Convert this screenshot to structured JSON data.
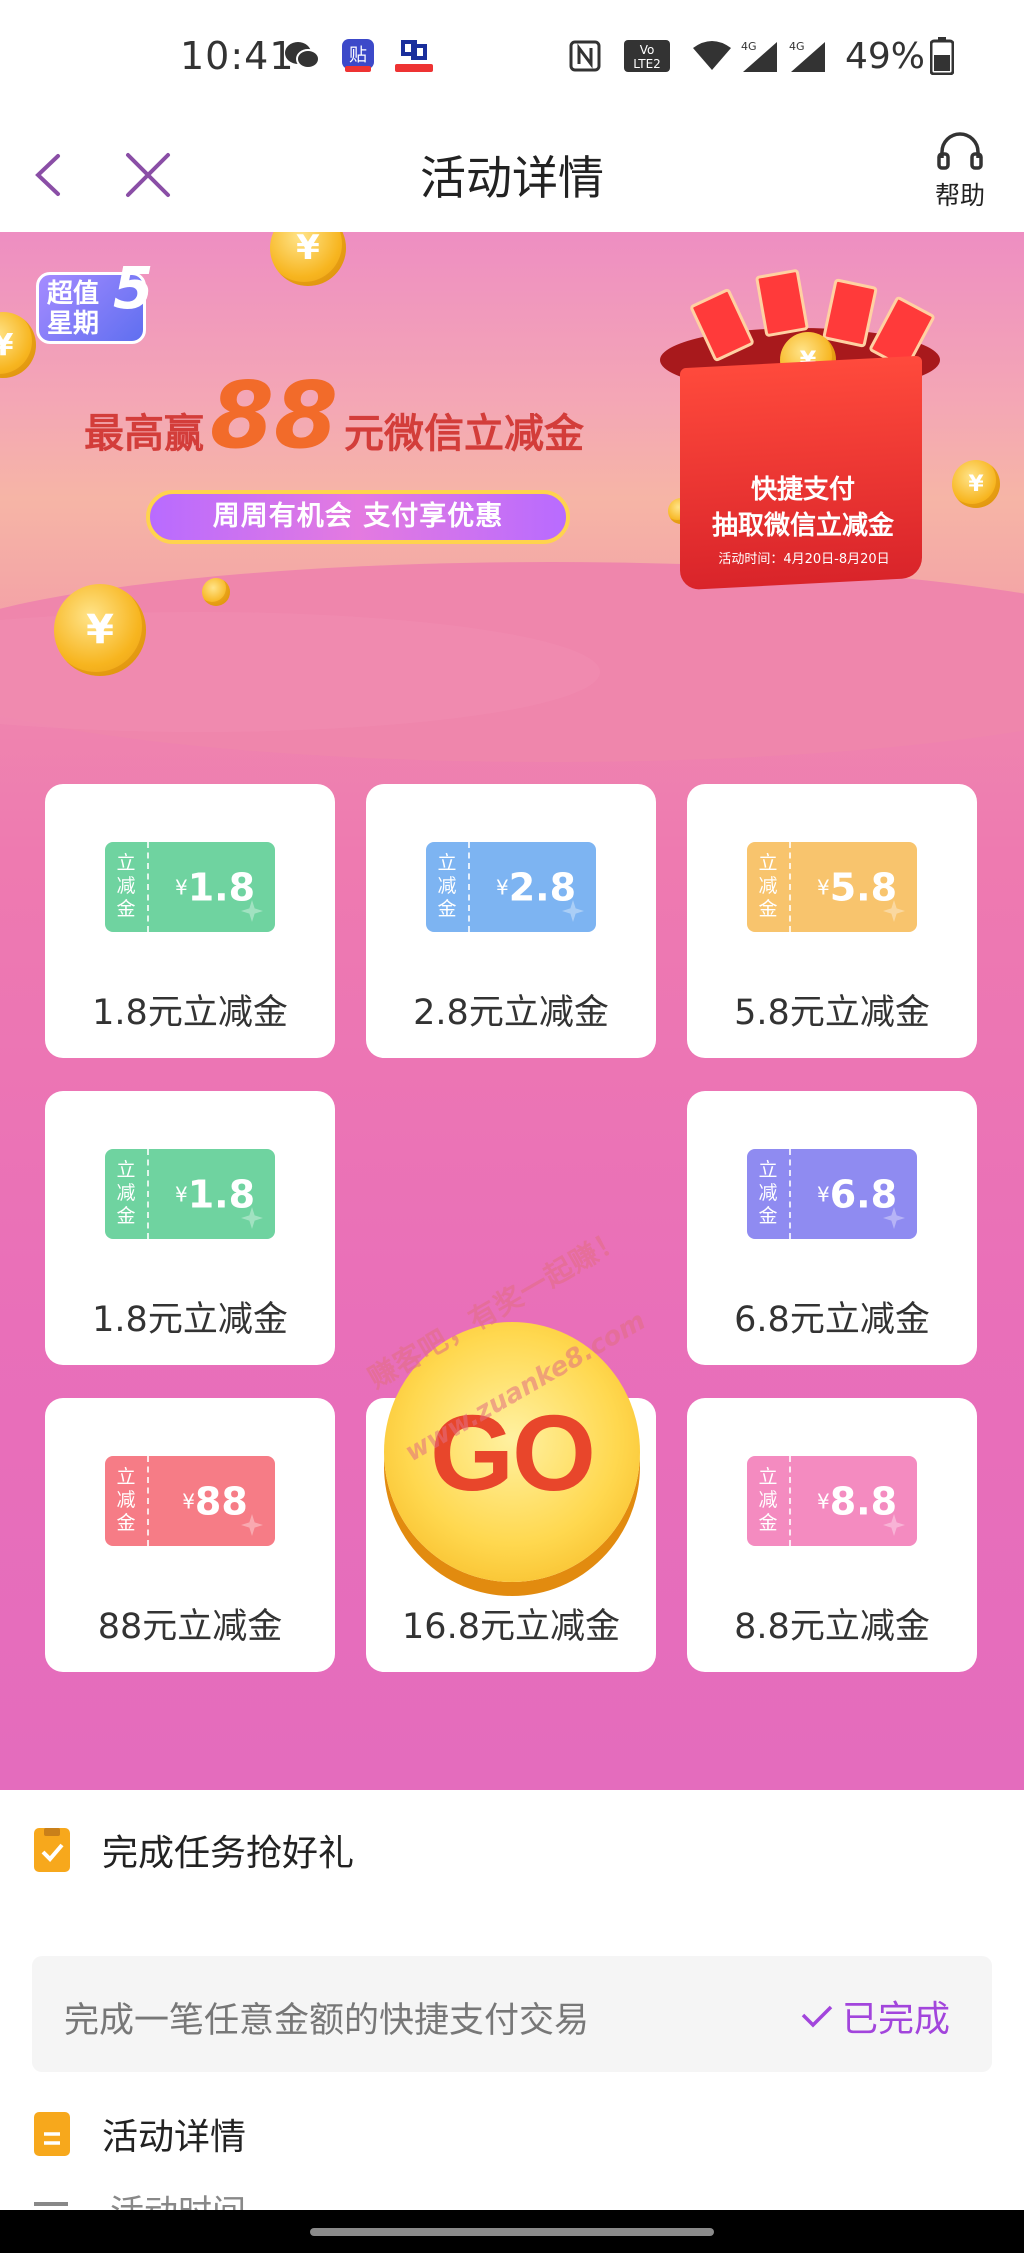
{
  "status_bar": {
    "time": "10:41",
    "battery": "49%",
    "icons": [
      "wechat-icon",
      "tie-app-icon",
      "bank-app-icon",
      "nfc-icon",
      "volte-icon",
      "wifi-icon",
      "signal-4g-icon",
      "signal-4g-icon",
      "battery-icon"
    ],
    "volte_label": "Vo LTE 2",
    "net_label": "4G"
  },
  "nav": {
    "title": "活动详情",
    "help_label": "帮助"
  },
  "banner": {
    "logo_text": "超值星期",
    "logo_number": "5",
    "headline_pre": "最高赢",
    "headline_amount": "88",
    "headline_post": "元微信立减金",
    "promo_pill": "周周有机会  支付享优惠",
    "gift_text_1": "快捷支付",
    "gift_text_2": "抽取微信立减金",
    "gift_date": "活动时间：4月20日-8月20日"
  },
  "prizes": [
    {
      "ticket_tag": "立减金",
      "currency": "¥",
      "value": "1.8",
      "label": "1.8元立减金",
      "color": "#6fd3a0"
    },
    {
      "ticket_tag": "立减金",
      "currency": "¥",
      "value": "2.8",
      "label": "2.8元立减金",
      "color": "#7db4f2"
    },
    {
      "ticket_tag": "立减金",
      "currency": "¥",
      "value": "5.8",
      "label": "5.8元立减金",
      "color": "#f8c46d"
    },
    {
      "ticket_tag": "立减金",
      "currency": "¥",
      "value": "1.8",
      "label": "1.8元立减金",
      "color": "#6fd3a0"
    },
    {
      "ticket_tag": "立减金",
      "currency": "¥",
      "value": "6.8",
      "label": "6.8元立减金",
      "color": "#8f8bf1"
    },
    {
      "ticket_tag": "立减金",
      "currency": "¥",
      "value": "88",
      "label": "88元立减金",
      "color": "#f67c86"
    },
    {
      "ticket_tag": "立减金",
      "currency": "¥",
      "value": "16.8",
      "label": "16.8元立减金",
      "color": "#f5877b"
    },
    {
      "ticket_tag": "立减金",
      "currency": "¥",
      "value": "8.8",
      "label": "8.8元立减金",
      "color": "#f48bc0"
    }
  ],
  "go_button": "GO",
  "watermark": {
    "line1": "赚客吧，有奖一起赚！",
    "line2": "www.zuanke8.com"
  },
  "tasks": {
    "title": "完成任务抢好礼",
    "items": [
      {
        "text": "完成一笔任意金额的快捷支付交易",
        "status": "已完成"
      }
    ]
  },
  "details": {
    "title": "活动详情",
    "first_line": "活动时间"
  }
}
